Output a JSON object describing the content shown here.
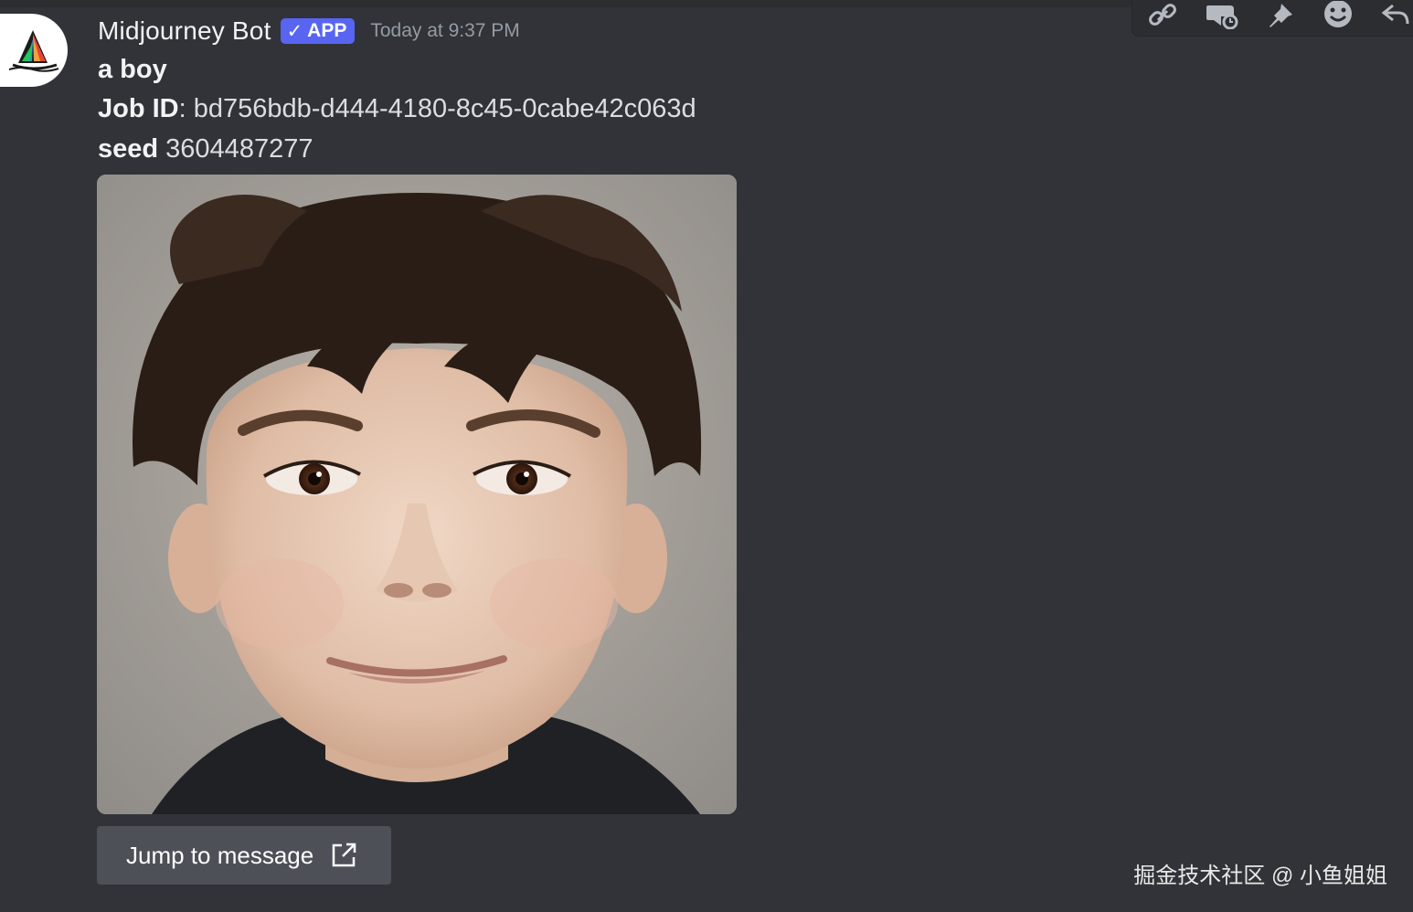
{
  "message": {
    "author": "Midjourney Bot",
    "badge": "APP",
    "badge_check": "✓",
    "timestamp": "Today at 9:37 PM",
    "prompt": "a boy",
    "job_label": "Job ID",
    "job_sep": ":",
    "job_id": "bd756bdb-d444-4180-8c45-0cabe42c063d",
    "seed_label": "seed",
    "seed_value": "3604487277",
    "jump_button": "Jump to message"
  },
  "toolbar": {
    "icons": [
      "link-icon",
      "thread-icon",
      "pin-icon",
      "emoji-icon",
      "reply-icon"
    ]
  },
  "watermark": "掘金技术社区 @ 小鱼姐姐",
  "colors": {
    "background": "#313338",
    "badge": "#5865f2",
    "button": "#4e5058",
    "timestamp": "#949ba4"
  }
}
